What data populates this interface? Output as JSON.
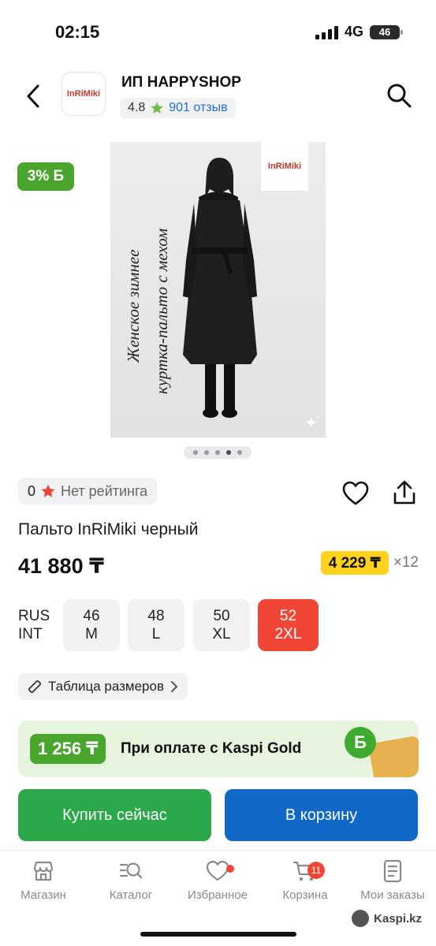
{
  "status_bar": {
    "time": "02:15",
    "network": "4G",
    "battery": "46"
  },
  "header": {
    "shop_logo_text": "InRiMiki",
    "shop_name": "ИП HAPPYSHOP",
    "rating": "4.8",
    "reviews": "901 отзыв"
  },
  "bonus_badge": "3% Б",
  "image": {
    "brand_tag": "InRiMiki",
    "caption_line1": "Женское зимнее",
    "caption_line2": "куртка-пальто с мехом",
    "dots_total": 5,
    "dots_active_index": 3
  },
  "product": {
    "rating_value": "0",
    "rating_text": "Нет рейтинга",
    "title": "Пальто InRiMiki черный",
    "price": "41 880 ₸",
    "installment_price": "4 229 ₸",
    "installment_term": "×12"
  },
  "sizes": {
    "scale_rus": "RUS",
    "scale_int": "INT",
    "options": [
      {
        "rus": "46",
        "int": "M"
      },
      {
        "rus": "48",
        "int": "L"
      },
      {
        "rus": "50",
        "int": "XL"
      },
      {
        "rus": "52",
        "int": "2XL"
      }
    ],
    "selected_index": 3,
    "table_label": "Таблица размеров"
  },
  "gold_banner": {
    "amount": "1 256 ₸",
    "text": "При оплате с Kaspi Gold",
    "coin": "Б"
  },
  "actions": {
    "buy": "Купить сейчас",
    "cart": "В корзину"
  },
  "nav": {
    "items": [
      {
        "label": "Магазин",
        "icon": "shop-icon"
      },
      {
        "label": "Каталог",
        "icon": "catalog-search-icon"
      },
      {
        "label": "Избранное",
        "icon": "heart-icon"
      },
      {
        "label": "Корзина",
        "icon": "cart-icon"
      },
      {
        "label": "Мои заказы",
        "icon": "orders-icon"
      }
    ],
    "cart_count": "11"
  },
  "watermark": "Kaspi.kz",
  "colors": {
    "green": "#4aa52d",
    "buy_green": "#2aa84a",
    "cart_blue": "#1268c6",
    "selected_red": "#f14635",
    "installment_yellow": "#ffd21e",
    "link_blue": "#1b6fd8"
  }
}
